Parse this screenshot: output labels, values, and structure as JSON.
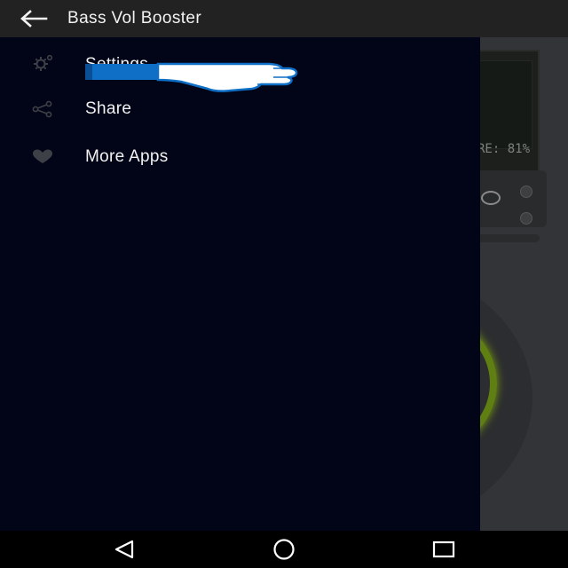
{
  "appbar": {
    "title": "Bass Vol Booster",
    "back_icon": "arrow-left-icon"
  },
  "background_app": {
    "lcd_readout": "RE: 81%"
  },
  "drawer": {
    "items": [
      {
        "label": "Settings",
        "icon": "gear-icon"
      },
      {
        "label": "Share",
        "icon": "share-icon"
      },
      {
        "label": "More Apps",
        "icon": "heart-icon"
      }
    ]
  },
  "overlay": {
    "icon": "pointing-hand-icon"
  },
  "navbar": {
    "back_icon": "nav-back-triangle-icon",
    "home_icon": "nav-home-circle-icon",
    "recents_icon": "nav-recents-square-icon"
  },
  "colors": {
    "appbar_bg": "#222223",
    "drawer_bg": "#020417",
    "accent_green": "#7da40f",
    "pointer_blue": "#0f6fc6"
  }
}
